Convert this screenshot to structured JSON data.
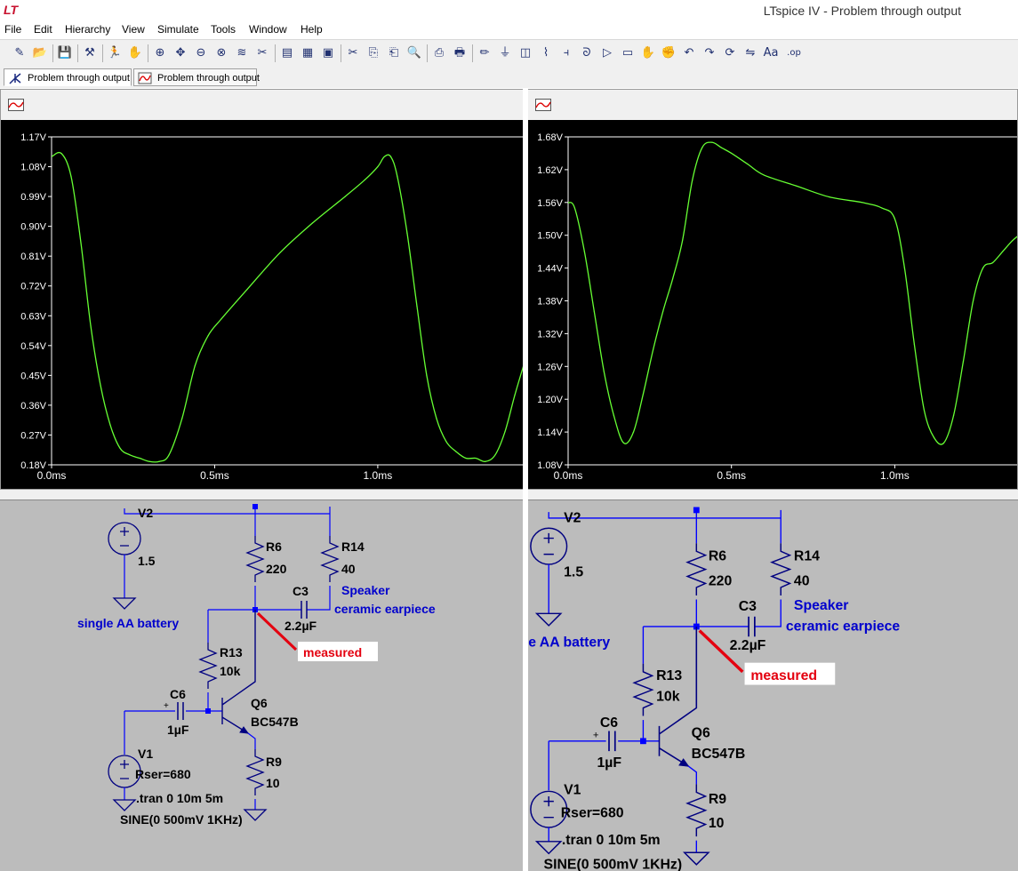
{
  "window": {
    "title": "LTspice IV - Problem through output"
  },
  "menu": [
    "File",
    "Edit",
    "Hierarchy",
    "View",
    "Simulate",
    "Tools",
    "Window",
    "Help"
  ],
  "toolbar_icons": [
    "new-schematic-icon",
    "open-icon",
    "save-icon",
    "control-panel-icon",
    "run-icon",
    "halt-icon",
    "zoom-in-icon",
    "pan-icon",
    "zoom-out-icon",
    "zoom-full-icon",
    "autoscale-icon",
    "delete-trace-icon",
    "tile-horizontal-icon",
    "cascade-icon",
    "close-window-icon",
    "cut-icon",
    "copy-icon",
    "paste-icon",
    "find-icon",
    "print-setup-icon",
    "print-icon",
    "wire-icon",
    "ground-icon",
    "label-icon",
    "resistor-icon",
    "capacitor-icon",
    "inductor-icon",
    "diode-icon",
    "component-icon",
    "move-icon",
    "drag-icon",
    "undo-icon",
    "redo-icon",
    "rotate-icon",
    "mirror-icon",
    "text-icon",
    "spice-directive-icon"
  ],
  "tabs": [
    {
      "label": "Problem through output",
      "icon": "schematic-icon",
      "active": true
    },
    {
      "label": "Problem through output",
      "icon": "waveform-icon",
      "active": false
    }
  ],
  "colors": {
    "trace": "#66ff33",
    "plot_bg": "#000000",
    "axis": "#ffffff",
    "schematic_bg": "#bcbcbc",
    "wire": "#0000ff",
    "component": "#000080",
    "comment": "#0000cd",
    "annotation": "#e4000f"
  },
  "plots": [
    {
      "chart_data": {
        "type": "line",
        "y_ticks": [
          "1.17V",
          "1.08V",
          "0.99V",
          "0.90V",
          "0.81V",
          "0.72V",
          "0.63V",
          "0.54V",
          "0.45V",
          "0.36V",
          "0.27V",
          "0.18V"
        ],
        "x_ticks": [
          "0.0ms",
          "0.5ms",
          "1.0ms"
        ],
        "ylim": [
          0.18,
          1.17
        ],
        "xlim": [
          0,
          1.45
        ],
        "x": [
          0,
          0.03,
          0.06,
          0.09,
          0.12,
          0.15,
          0.18,
          0.21,
          0.24,
          0.27,
          0.3,
          0.33,
          0.36,
          0.4,
          0.44,
          0.48,
          0.52,
          0.6,
          0.7,
          0.8,
          0.9,
          0.96,
          1.0,
          1.02,
          1.04,
          1.06,
          1.09,
          1.12,
          1.15,
          1.18,
          1.21,
          1.24,
          1.27,
          1.3,
          1.33,
          1.36,
          1.39,
          1.42,
          1.45
        ],
        "y": [
          1.11,
          1.12,
          1.05,
          0.85,
          0.6,
          0.42,
          0.3,
          0.23,
          0.21,
          0.2,
          0.19,
          0.19,
          0.21,
          0.32,
          0.48,
          0.57,
          0.62,
          0.71,
          0.82,
          0.91,
          0.99,
          1.04,
          1.08,
          1.11,
          1.11,
          1.05,
          0.88,
          0.66,
          0.45,
          0.32,
          0.25,
          0.22,
          0.2,
          0.2,
          0.19,
          0.21,
          0.28,
          0.39,
          0.49
        ],
        "grid": false
      }
    },
    {
      "chart_data": {
        "type": "line",
        "y_ticks": [
          "1.68V",
          "1.62V",
          "1.56V",
          "1.50V",
          "1.44V",
          "1.38V",
          "1.32V",
          "1.26V",
          "1.20V",
          "1.14V",
          "1.08V"
        ],
        "x_ticks": [
          "0.0ms",
          "0.5ms",
          "1.0ms"
        ],
        "ylim": [
          1.08,
          1.68
        ],
        "xlim": [
          0,
          1.38
        ],
        "x": [
          0,
          0.02,
          0.05,
          0.08,
          0.11,
          0.14,
          0.17,
          0.2,
          0.23,
          0.26,
          0.29,
          0.32,
          0.35,
          0.38,
          0.41,
          0.44,
          0.47,
          0.5,
          0.55,
          0.6,
          0.7,
          0.8,
          0.9,
          0.96,
          1.0,
          1.03,
          1.06,
          1.09,
          1.12,
          1.15,
          1.18,
          1.21,
          1.24,
          1.27,
          1.3,
          1.33,
          1.36,
          1.38
        ],
        "y": [
          1.56,
          1.55,
          1.47,
          1.36,
          1.25,
          1.17,
          1.12,
          1.14,
          1.21,
          1.29,
          1.36,
          1.42,
          1.49,
          1.6,
          1.66,
          1.67,
          1.66,
          1.65,
          1.63,
          1.61,
          1.59,
          1.57,
          1.56,
          1.55,
          1.53,
          1.44,
          1.3,
          1.18,
          1.13,
          1.12,
          1.17,
          1.27,
          1.38,
          1.44,
          1.45,
          1.47,
          1.49,
          1.5
        ],
        "grid": false
      }
    }
  ],
  "schematics": [
    {
      "labels": {
        "v2_name": "V2",
        "v2_value": "1.5",
        "battery_comment": "single AA battery",
        "r6_name": "R6",
        "r6_value": "220",
        "r14_name": "R14",
        "r14_value": "40",
        "c3_name": "C3",
        "c3_value": "2.2µF",
        "speaker_line1": "Speaker",
        "speaker_line2": "ceramic earpiece",
        "measured": "measured",
        "r13_name": "R13",
        "r13_value": "10k",
        "c6_name": "C6",
        "c6_value": "1µF",
        "q6_name": "Q6",
        "q6_value": "BC547B",
        "v1_name": "V1",
        "v1_rser": "Rser=680",
        "r9_name": "R9",
        "r9_value": "10",
        "tran": ".tran 0 10m 5m",
        "sine": "SINE(0 500mV 1KHz)"
      }
    },
    {
      "labels": {
        "v2_name": "V2",
        "v2_value": "1.5",
        "battery_comment": "single AA battery",
        "r6_name": "R6",
        "r6_value": "220",
        "r14_name": "R14",
        "r14_value": "40",
        "c3_name": "C3",
        "c3_value": "2.2µF",
        "speaker_line1": "Speaker",
        "speaker_line2": "ceramic earpiece",
        "measured": "measured",
        "r13_name": "R13",
        "r13_value": "10k",
        "c6_name": "C6",
        "c6_value": "1µF",
        "q6_name": "Q6",
        "q6_value": "BC547B",
        "v1_name": "V1",
        "v1_rser": "Rser=680",
        "r9_name": "R9",
        "r9_value": "10",
        "tran": ".tran 0 10m 5m",
        "sine": "SINE(0 500mV 1KHz)"
      }
    }
  ]
}
